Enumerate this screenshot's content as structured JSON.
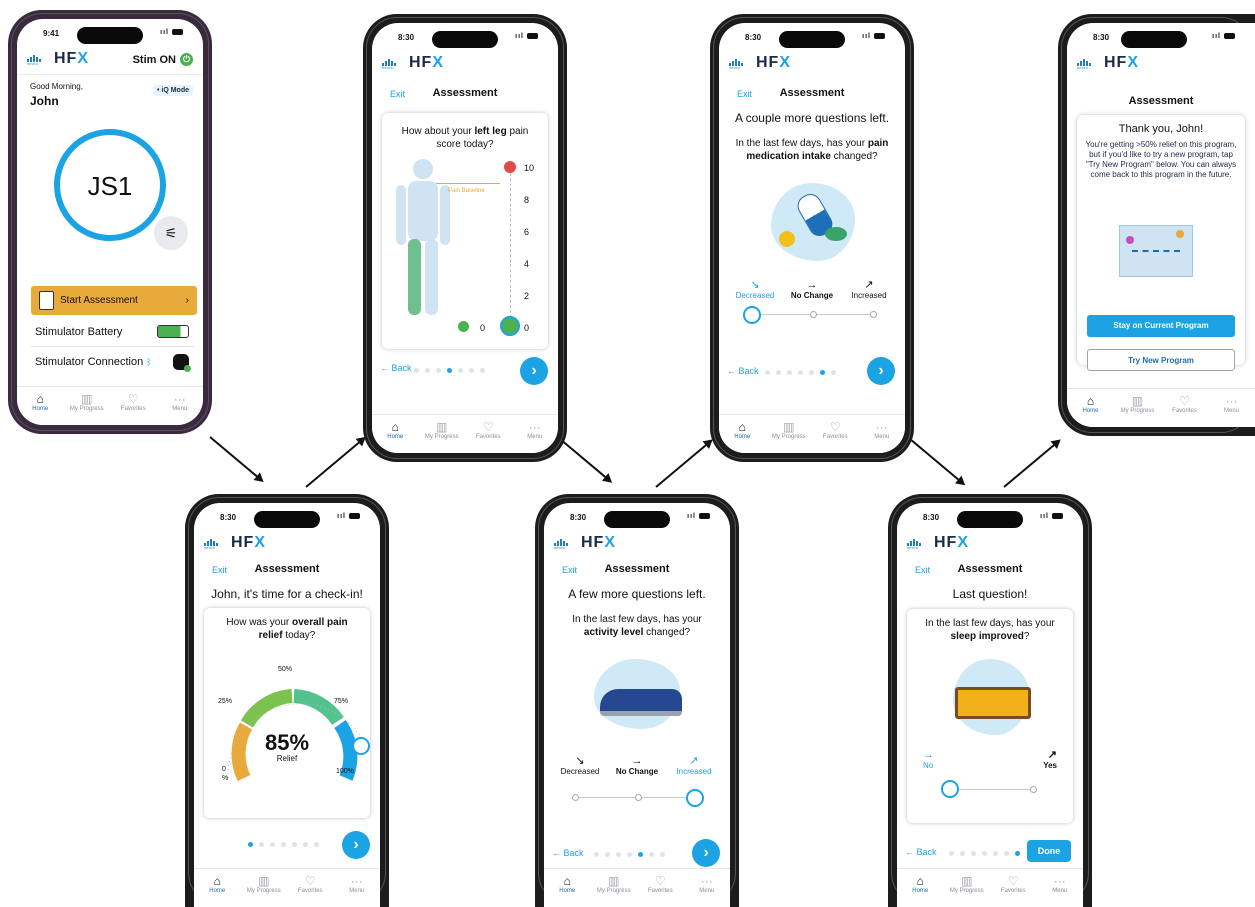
{
  "brand": {
    "maker": "nevro",
    "product_main": "HF",
    "product_accent": "X"
  },
  "colors": {
    "accent": "#1ba3e3",
    "orange": "#e8aa3a",
    "green": "#4caf50",
    "navy": "#1b2a48"
  },
  "tabbar": [
    {
      "label": "Home",
      "icon": "home-icon"
    },
    {
      "label": "My Progress",
      "icon": "chart-icon"
    },
    {
      "label": "Favorites",
      "icon": "heart-icon"
    },
    {
      "label": "Menu",
      "icon": "more-icon"
    }
  ],
  "home": {
    "time": "9:41",
    "stim_label": "Stim ON",
    "greeting": "Good Morning,",
    "user_name": "John",
    "mode_badge": "iQ Mode",
    "program": "JS1",
    "start_assessment": "Start Assessment",
    "battery_label": "Stimulator Battery",
    "battery_level": 0.75,
    "connection_label": "Stimulator Connection"
  },
  "common": {
    "time": "8:30",
    "exit": "Exit",
    "title": "Assessment",
    "back": "Back",
    "done": "Done"
  },
  "checkin": {
    "lead": "John, it's time for a check-in!",
    "q_pre": "How was your ",
    "q_bold": "overall pain relief",
    "q_post": " today?",
    "value": "85%",
    "value_label": "Relief",
    "ticks": {
      "t0": "0",
      "t0b": "%",
      "t25": "25%",
      "t50": "50%",
      "t75": "75%",
      "t100": "100%"
    },
    "step": 1
  },
  "leg": {
    "q_pre": "How about your ",
    "q_bold": "left leg",
    "q_post": " pain score today?",
    "baseline": "Pain Baseline",
    "scale": [
      "10",
      "8",
      "6",
      "4",
      "2",
      "0"
    ],
    "selected_score": "0",
    "step": 4
  },
  "activity": {
    "lead": "A few more questions left.",
    "q_pre": "In the last few days, has your ",
    "q_bold": "activity level",
    "q_post": " changed?",
    "options": [
      "Decreased",
      "No Change",
      "Increased"
    ],
    "selected": 2,
    "step": 5
  },
  "medication": {
    "lead": "A couple more questions left.",
    "q_pre": "In the last few days, has your ",
    "q_bold": "pain medication intake",
    "q_post": " changed?",
    "options": [
      "Decreased",
      "No Change",
      "Increased"
    ],
    "selected": 0,
    "step": 6
  },
  "sleep": {
    "lead": "Last question!",
    "q_pre": "In the last few days, has your ",
    "q_bold": "sleep improved",
    "q_post": "?",
    "options": [
      "No",
      "Yes"
    ],
    "selected": 0,
    "step": 7
  },
  "thanks": {
    "heading": "Thank you, John!",
    "body": "You're getting >50% relief on this program, but if you'd like to try a new program, tap \"Try New Program\" below. You can always come back to this program in the future.",
    "primary": "Stay on Current Program",
    "secondary": "Try New Program"
  }
}
